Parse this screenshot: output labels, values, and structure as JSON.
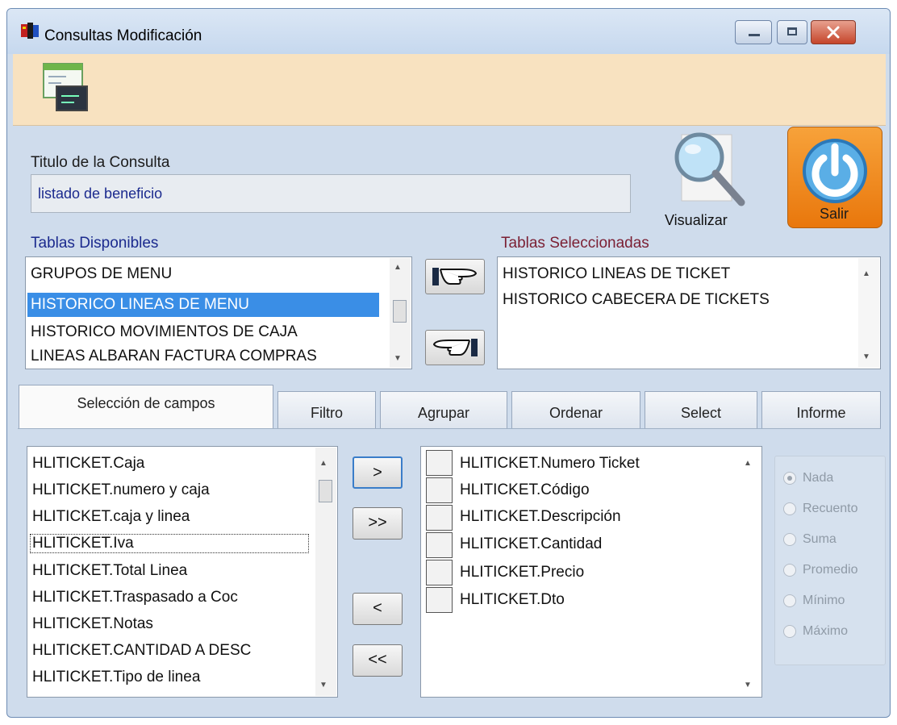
{
  "window": {
    "title": "Consultas Modificación",
    "icon": "app-icon"
  },
  "toolbar": {
    "icon": "query-designer-icon"
  },
  "query": {
    "title_label": "Titulo de la Consulta",
    "title_value": "listado de beneficio"
  },
  "actions": {
    "visualizar_label": "Visualizar",
    "salir_label": "Salir"
  },
  "tables": {
    "available_label": "Tablas Disponibles",
    "available_items": [
      "GRUPOS DE MENU",
      "HISTORICO LINEAS DE MENU",
      "HISTORICO MOVIMIENTOS DE CAJA",
      "LINEAS ALBARAN FACTURA COMPRAS"
    ],
    "available_selected_index": 1,
    "selected_label": "Tablas Seleccionadas",
    "selected_items": [
      "HISTORICO LINEAS DE TICKET",
      "HISTORICO CABECERA DE TICKETS"
    ]
  },
  "tabs": [
    {
      "label": "Selección de campos",
      "active": true
    },
    {
      "label": "Filtro",
      "active": false
    },
    {
      "label": "Agrupar",
      "active": false
    },
    {
      "label": "Ordenar",
      "active": false
    },
    {
      "label": "Select",
      "active": false
    },
    {
      "label": "Informe",
      "active": false
    }
  ],
  "fields": {
    "available": [
      "HLITICKET.Caja",
      "HLITICKET.numero y caja",
      "HLITICKET.caja y linea",
      "HLITICKET.Iva",
      "HLITICKET.Total Linea",
      "HLITICKET.Traspasado a Coc",
      "HLITICKET.Notas",
      "HLITICKET.CANTIDAD A DESC",
      "HLITICKET.Tipo de linea"
    ],
    "available_focused_index": 3,
    "selected": [
      "HLITICKET.Numero Ticket",
      "HLITICKET.Código",
      "HLITICKET.Descripción",
      "HLITICKET.Cantidad",
      "HLITICKET.Precio",
      "HLITICKET.Dto"
    ],
    "buttons": {
      "add_one": ">",
      "add_all": ">>",
      "remove_one": "<",
      "remove_all": "<<"
    }
  },
  "aggregate": {
    "options": [
      "Nada",
      "Recuento",
      "Suma",
      "Promedio",
      "Mínimo",
      "Máximo"
    ],
    "selected_index": 0,
    "enabled": false
  },
  "colors": {
    "toolbar_bg": "#f8e2c0",
    "window_bg": "#cfdcec",
    "selection": "#3a8ee6",
    "salir_orange": "#f08a1c"
  }
}
